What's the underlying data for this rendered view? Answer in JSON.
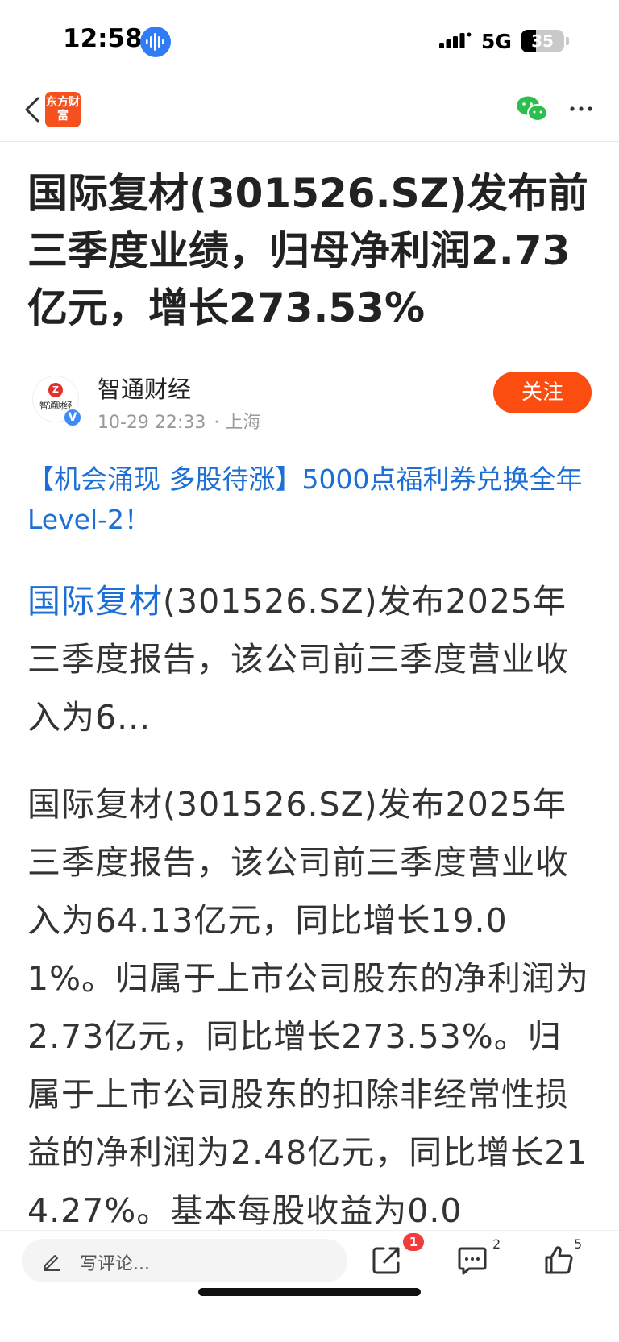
{
  "status_bar": {
    "time": "12:58",
    "network": "5G",
    "battery": "35",
    "battery_level": 0.35
  },
  "nav": {
    "logo_text": "东方财富",
    "back_icon": "chevron-left-icon",
    "share_icon": "wechat-icon",
    "more_icon": "more-icon"
  },
  "article": {
    "title": "国际复材(301526.SZ)发布前三季度业绩，归母净利润2.73亿元，增长273.53%",
    "author": {
      "name": "智通财经",
      "avatar_text": "智通财经",
      "date": "10-29 22:33",
      "location": "· 上海",
      "follow_label": "关注"
    },
    "promo": "【机会涌现 多股待涨】5000点福利券兑换全年Level-2！",
    "summary_link": "国际复材",
    "summary_rest": "(301526.SZ)发布2025年三季度报告，该公司前三季度营业收入为6...",
    "body": "国际复材(301526.SZ)发布2025年三季度报告，该公司前三季度营业收入为64.13亿元，同比增长19.01%。归属于上市公司股东的净利润为2.73亿元，同比增长273.53%。归属于上市公司股东的扣除非经常性损益的净利润为2.48亿元，同比增长214.27%。基本每股收益为0.0"
  },
  "bottom_bar": {
    "comment_placeholder": "写评论...",
    "share_badge": "1",
    "comment_count": "2",
    "like_count": "5"
  },
  "colors": {
    "accent": "#fa4d0f",
    "link": "#1d6fd6",
    "badge": "#f23c3c"
  }
}
